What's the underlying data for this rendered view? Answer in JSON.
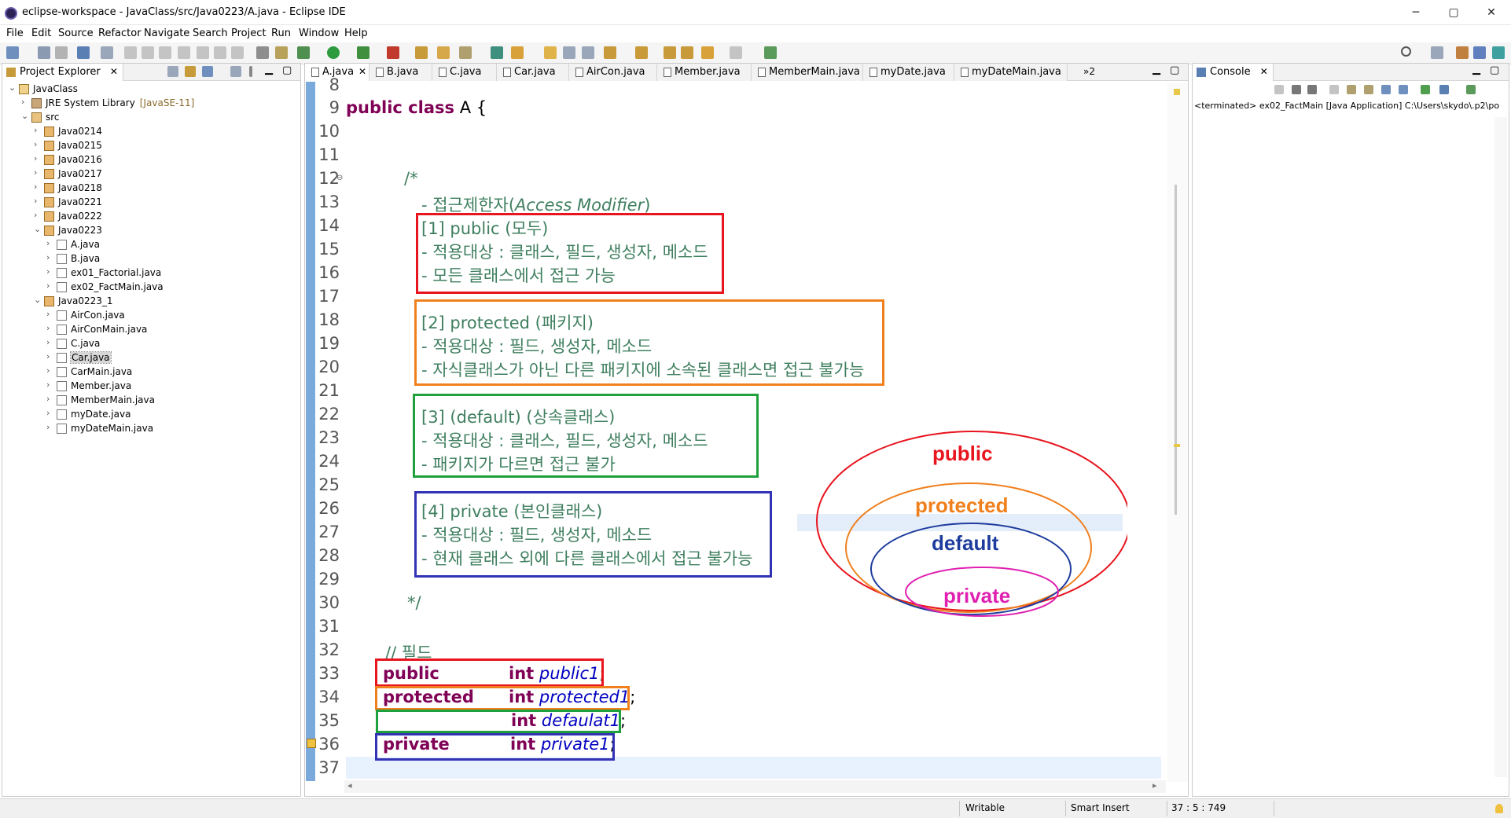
{
  "window": {
    "title": "eclipse-workspace - JavaClass/src/Java0223/A.java - Eclipse IDE",
    "minimize": "─",
    "maximize": "▢",
    "close": "✕"
  },
  "menu": [
    "File",
    "Edit",
    "Source",
    "Refactor",
    "Navigate",
    "Search",
    "Project",
    "Run",
    "Window",
    "Help"
  ],
  "project_explorer": {
    "title": "Project Explorer",
    "tree": {
      "project": "JavaClass",
      "jre": "JRE System Library",
      "jre_decoration": "[JavaSE-11]",
      "src": "src",
      "packages_top": [
        "Java0214",
        "Java0215",
        "Java0216",
        "Java0217",
        "Java0218",
        "Java0221",
        "Java0222"
      ],
      "pkg_0223": "Java0223",
      "files_0223": [
        "A.java",
        "B.java",
        "ex01_Factorial.java",
        "ex02_FactMain.java"
      ],
      "pkg_0223_1": "Java0223_1",
      "files_0223_1": [
        "AirCon.java",
        "AirConMain.java",
        "C.java",
        "Car.java",
        "CarMain.java",
        "Member.java",
        "MemberMain.java",
        "myDate.java",
        "myDateMain.java"
      ]
    }
  },
  "editor": {
    "tabs": [
      "A.java",
      "B.java",
      "C.java",
      "Car.java",
      "AirCon.java",
      "Member.java",
      "MemberMain.java",
      "myDate.java",
      "myDateMain.java"
    ],
    "overflow": "»2",
    "line_numbers": [
      "8",
      "9",
      "10",
      "11",
      "12",
      "13",
      "14",
      "15",
      "16",
      "17",
      "18",
      "19",
      "20",
      "21",
      "22",
      "23",
      "24",
      "25",
      "26",
      "27",
      "28",
      "29",
      "30",
      "31",
      "32",
      "33",
      "34",
      "35",
      "36",
      "37"
    ],
    "code": {
      "l9_kw": "public class",
      "l9_rest": "A {",
      "l12": "/*",
      "l13_a": "- 접근제한자(",
      "l13_b": "Access Modifier",
      "l13_c": ")",
      "l14": "[1] public (모두)",
      "l15": "- 적용대상 : 클래스, 필드, 생성자, 메소드",
      "l16": "- 모든 클래스에서 접근 가능",
      "l18": "[2] protected (패키지)",
      "l19": "- 적용대상 : 필드, 생성자, 메소드",
      "l20": "- 자식클래스가 아닌 다른 패키지에 소속된 클래스면 접근 불가능",
      "l22": "[3] (default) (상속클래스)",
      "l23": "- 적용대상 : 클래스, 필드, 생성자, 메소드",
      "l24": "- 패키지가 다르면 접근 불가",
      "l26": "[4] private (본인클래스)",
      "l27": "- 적용대상 : 필드, 생성자, 메소드",
      "l28": "- 현재 클래스 외에 다른 클래스에서 접근 불가능",
      "l30": "*/",
      "l32": "// 필드",
      "l33_mod": "public",
      "l33_type": "int",
      "l33_name": "public1",
      "l34_mod": "protected",
      "l34_type": "int",
      "l34_name": "protected1",
      "l35_type": "int",
      "l35_name": "defaulat1",
      "l36_mod": "private",
      "l36_type": "int",
      "l36_name": "private1",
      "semi": ";"
    },
    "diagram": {
      "public": "public",
      "protected": "protected",
      "default": "default",
      "private": "private"
    }
  },
  "console": {
    "title": "Console",
    "text": "<terminated> ex02_FactMain [Java Application] C:\\Users\\skydo\\.p2\\po"
  },
  "status": {
    "writable": "Writable",
    "insert": "Smart Insert",
    "position": "37 : 5 : 749"
  },
  "colors": {
    "public": "#e8141e",
    "protected": "#f0801e",
    "default": "#1ea03c",
    "private": "#3232b4",
    "comment": "#3f7f5f",
    "keyword": "#7f0055",
    "field": "#0000c0"
  }
}
